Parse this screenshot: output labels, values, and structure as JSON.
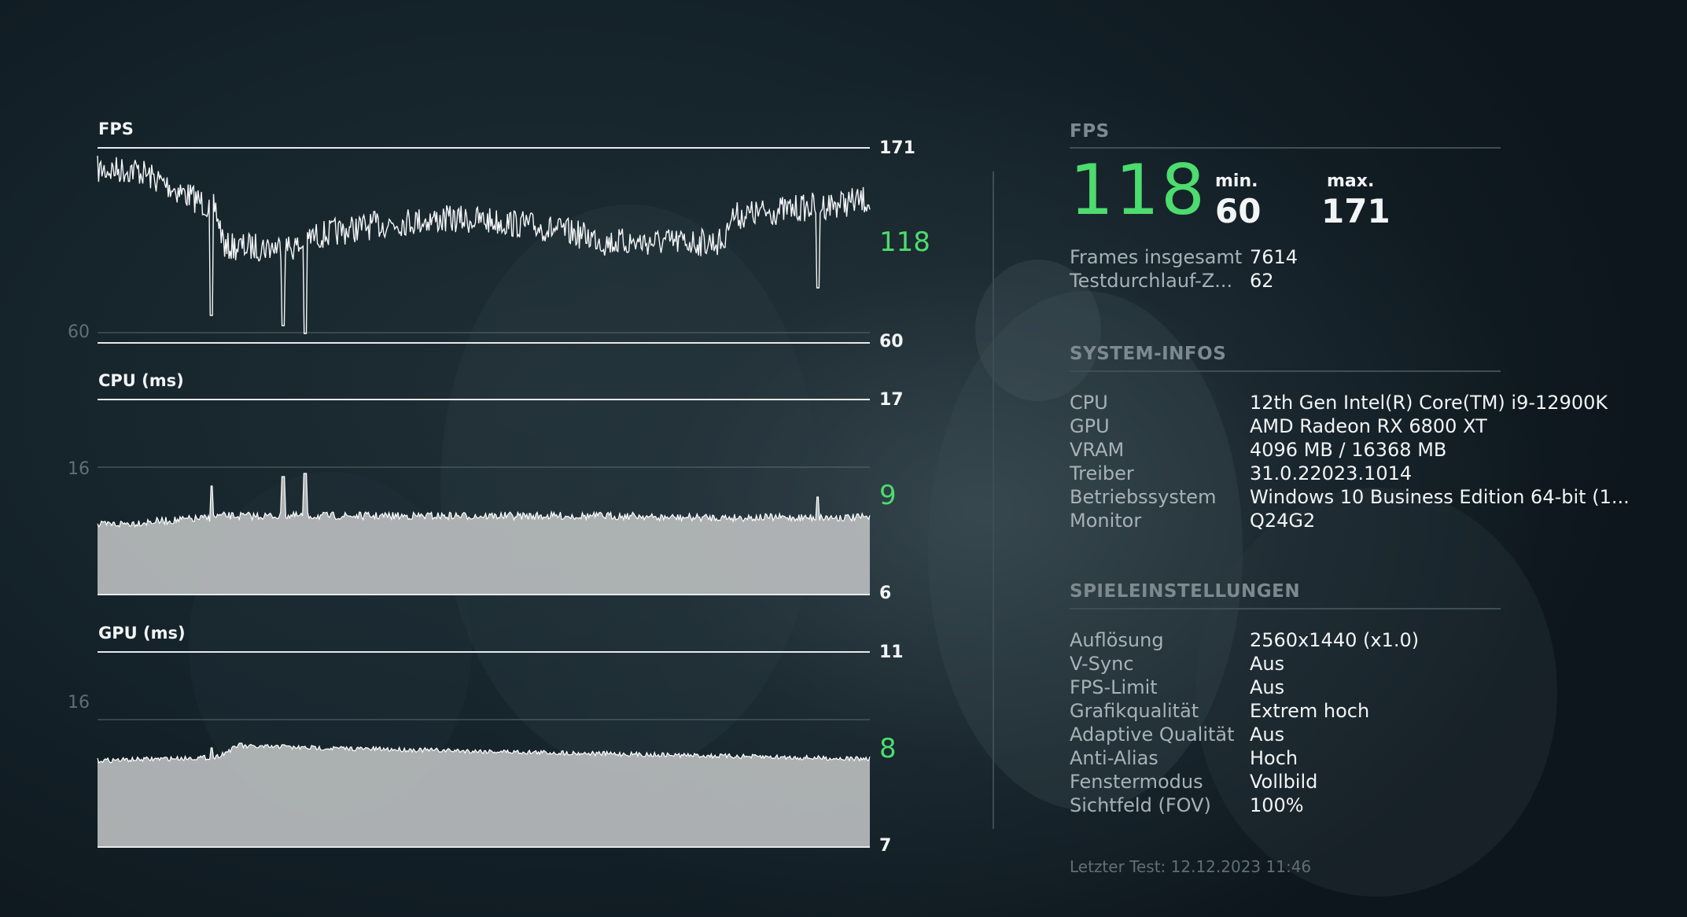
{
  "graphs": {
    "fps": {
      "title": "FPS",
      "max_label": "171",
      "min_label": "60",
      "current_label": "118",
      "side_label": "60",
      "range": [
        60,
        171
      ],
      "current": 118
    },
    "cpu": {
      "title": "CPU (ms)",
      "max_label": "17",
      "min_label": "6",
      "current_label": "9",
      "side_label": "16",
      "range": [
        6,
        17
      ],
      "current": 9
    },
    "gpu": {
      "title": "GPU (ms)",
      "max_label": "11",
      "min_label": "7",
      "current_label": "8",
      "side_label": "16",
      "range": [
        7,
        11
      ],
      "current": 8
    }
  },
  "summary": {
    "section_title": "FPS",
    "average": "118",
    "min_label": "min.",
    "min_value": "60",
    "max_label": "max.",
    "max_value": "171",
    "rows": [
      {
        "label": "Frames insgesamt",
        "value": "7614"
      },
      {
        "label": "Testdurchlauf-Z...",
        "value": "62"
      }
    ]
  },
  "system": {
    "section_title": "SYSTEM-INFOS",
    "rows": [
      {
        "label": "CPU",
        "value": "12th Gen Intel(R) Core(TM) i9-12900K"
      },
      {
        "label": "GPU",
        "value": "AMD Radeon RX 6800 XT"
      },
      {
        "label": "VRAM",
        "value": "4096 MB / 16368 MB"
      },
      {
        "label": "Treiber",
        "value": "31.0.22023.1014"
      },
      {
        "label": "Betriebssystem",
        "value": "Windows 10 Business Edition 64-bit (1..."
      },
      {
        "label": "Monitor",
        "value": "Q24G2"
      }
    ]
  },
  "settings": {
    "section_title": "SPIELEINSTELLUNGEN",
    "rows": [
      {
        "label": "Auflösung",
        "value": "2560x1440 (x1.0)"
      },
      {
        "label": "V-Sync",
        "value": "Aus"
      },
      {
        "label": "FPS-Limit",
        "value": "Aus"
      },
      {
        "label": "Grafikqualität",
        "value": "Extrem hoch"
      },
      {
        "label": "Adaptive Qualität",
        "value": "Aus"
      },
      {
        "label": "Anti-Alias",
        "value": "Hoch"
      },
      {
        "label": "Fenstermodus",
        "value": "Vollbild"
      },
      {
        "label": "Sichtfeld (FOV)",
        "value": "100%"
      }
    ]
  },
  "footer": "Letzter Test: 12.12.2023 11:46",
  "colors": {
    "accent_green": "#4ddc6e",
    "graph_fill": "#b9bcbd",
    "text": "#f2f4f5",
    "muted": "#7c8a90"
  }
}
